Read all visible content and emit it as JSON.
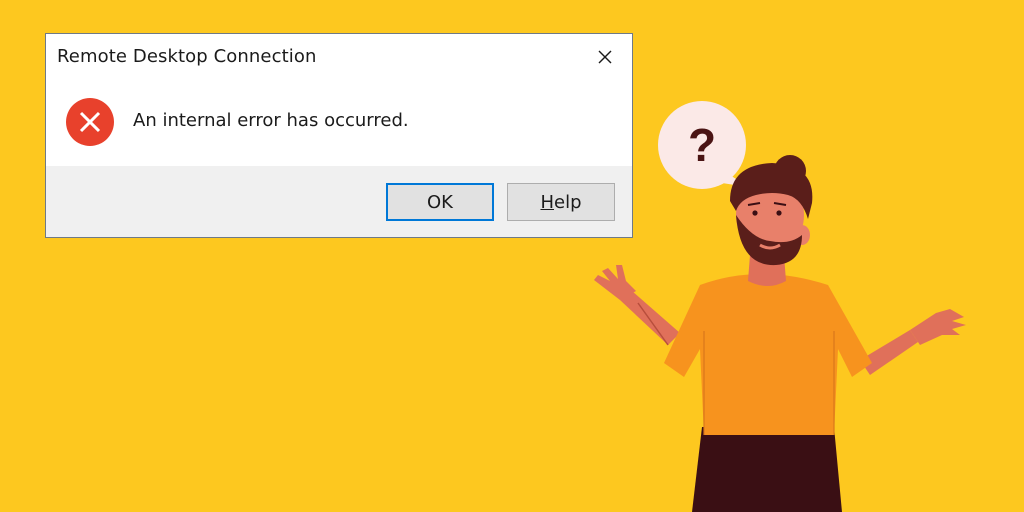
{
  "dialog": {
    "title": "Remote Desktop Connection",
    "message": "An internal error has occurred.",
    "buttons": {
      "ok_label": "OK",
      "help_first": "H",
      "help_rest": "elp"
    },
    "icon": "error-icon",
    "close_icon": "close-icon"
  },
  "illustration": {
    "speech_bubble_text": "?"
  },
  "colors": {
    "background": "#fdc81f",
    "error_red": "#e8412c",
    "ok_border": "#0078d7",
    "shirt": "#f7931e",
    "skin": "#e0705a",
    "hair": "#5a1e1a"
  }
}
